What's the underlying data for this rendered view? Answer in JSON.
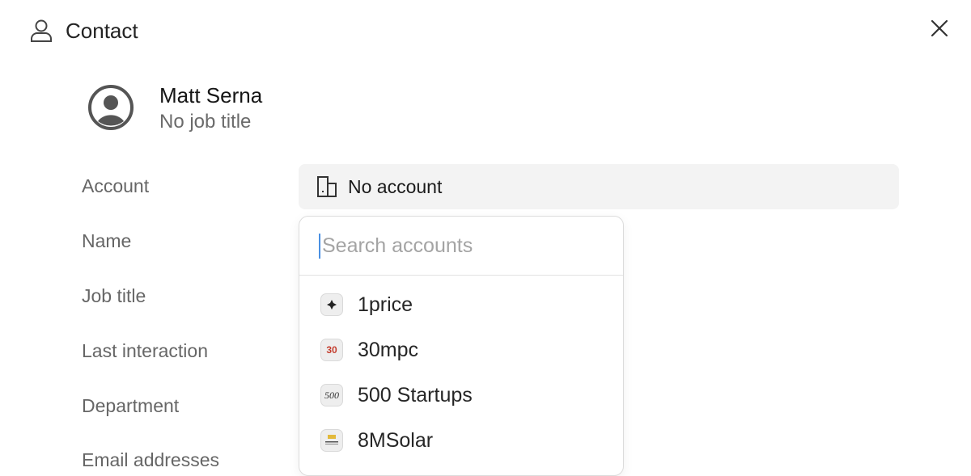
{
  "header": {
    "title": "Contact"
  },
  "profile": {
    "name": "Matt Serna",
    "job_title": "No job title"
  },
  "fields": {
    "account_label": "Account",
    "name_label": "Name",
    "job_title_label": "Job title",
    "last_interaction_label": "Last interaction",
    "department_label": "Department",
    "email_label": "Email addresses"
  },
  "account": {
    "value": "No account"
  },
  "dropdown": {
    "search_placeholder": "Search accounts",
    "items": [
      {
        "name": "1price",
        "logo": "1price-logo"
      },
      {
        "name": "30mpc",
        "logo_text": "30",
        "logo": "30mpc-logo"
      },
      {
        "name": "500 Startups",
        "logo_text": "500",
        "logo": "500-startups-logo"
      },
      {
        "name": "8MSolar",
        "logo": "8msolar-logo"
      }
    ]
  },
  "icons": {
    "header": "person-icon",
    "close": "close-icon",
    "avatar": "user-circle-icon",
    "account": "building-icon"
  }
}
